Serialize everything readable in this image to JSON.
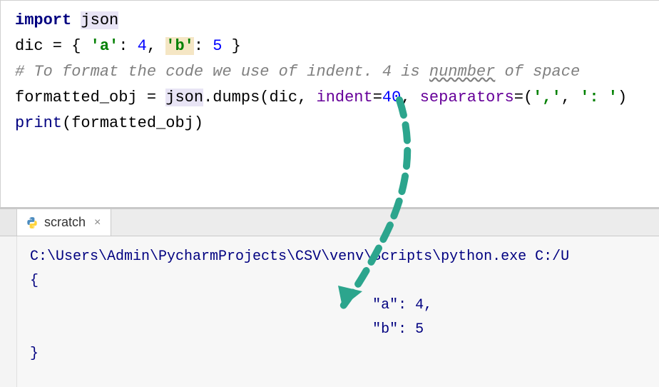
{
  "editor": {
    "line1": {
      "kw_import": "import",
      "sp": " ",
      "module": "json"
    },
    "line2": {
      "var": "dic",
      "eq": " = { ",
      "key_a": "'a'",
      "colon1": ": ",
      "val_a": "4",
      "comma": ", ",
      "key_b": "'b'",
      "colon2": ": ",
      "val_b": "5",
      "close": " }"
    },
    "line3": {
      "comment": "# To format the code we use of indent. 4 is ",
      "commentWavy": "nunmber",
      "comment2": " of space"
    },
    "line4": {
      "var": "formatted_obj",
      "eq": " = ",
      "mod": "json",
      "dot": ".",
      "fn": "dumps",
      "open": "(dic, ",
      "p1": "indent",
      "eq1": "=",
      "v1": "40",
      "c": ", ",
      "p2": "separators",
      "eq2": "=(",
      "s1": "','",
      "cc": ", ",
      "s2": "': '",
      "close": ")"
    },
    "line5": {
      "fn": "print",
      "open": "(formatted_obj)"
    }
  },
  "tab": {
    "name": "scratch"
  },
  "output": {
    "path": "C:\\Users\\Admin\\PycharmProjects\\CSV\\venv\\Scripts\\python.exe C:/U",
    "brace_open": "{",
    "line_a": "                                        \"a\": 4,",
    "line_b": "                                        \"b\": 5",
    "brace_close": "}"
  }
}
